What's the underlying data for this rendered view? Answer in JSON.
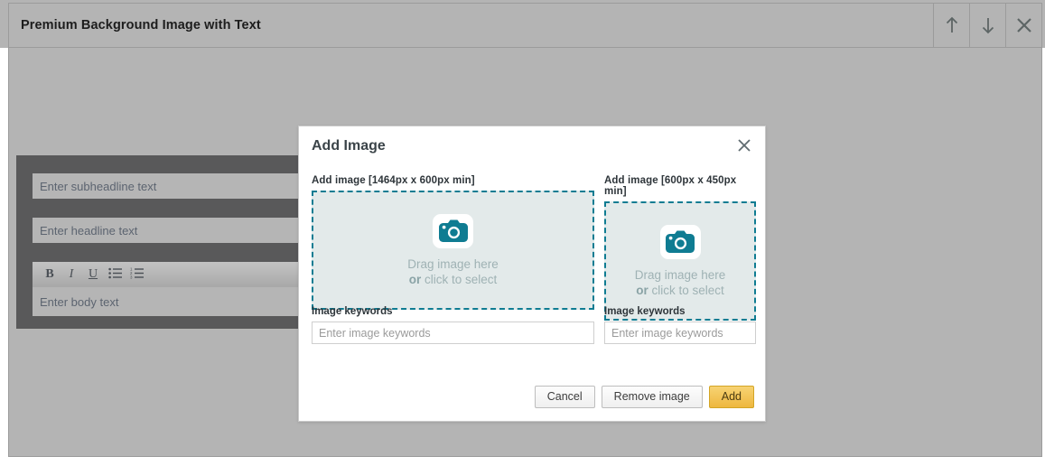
{
  "widget": {
    "title": "Premium Background Image with Text",
    "actions": [
      {
        "name": "move-up",
        "icon": "arrow-up-icon"
      },
      {
        "name": "move-down",
        "icon": "arrow-down-icon"
      },
      {
        "name": "close",
        "icon": "close-icon"
      }
    ]
  },
  "editor": {
    "subheadline_placeholder": "Enter subheadline text",
    "headline_placeholder": "Enter headline text",
    "body_placeholder": "Enter body text",
    "toolbar": [
      {
        "name": "bold",
        "label": "B"
      },
      {
        "name": "italic",
        "label": "I"
      },
      {
        "name": "underline",
        "label": "U"
      },
      {
        "name": "unordered-list",
        "label": ""
      },
      {
        "name": "ordered-list",
        "label": ""
      }
    ]
  },
  "modal": {
    "title": "Add Image",
    "close_label": "×",
    "uploads": [
      {
        "label": "Add image [1464px x 600px min]",
        "drag_text": "Drag image here",
        "or_text": "or",
        "click_text": " click to select",
        "keywords_label": "Image keywords",
        "keywords_value": "",
        "keywords_placeholder": "Enter image keywords"
      },
      {
        "label": "Add image [600px x 450px min]",
        "drag_text": "Drag image here",
        "or_text": "or",
        "click_text": " click to select",
        "keywords_label": "Image keywords",
        "keywords_value": "",
        "keywords_placeholder": "Enter image keywords"
      }
    ],
    "buttons": {
      "cancel": "Cancel",
      "remove": "Remove image",
      "add": "Add"
    }
  },
  "colors": {
    "teal": "#0f7c92",
    "dropzone_bg": "#e3eaea",
    "chrome_gray": "#b4b4b4",
    "panel_dark": "#59595a",
    "primary_button": "#eeb73f"
  }
}
